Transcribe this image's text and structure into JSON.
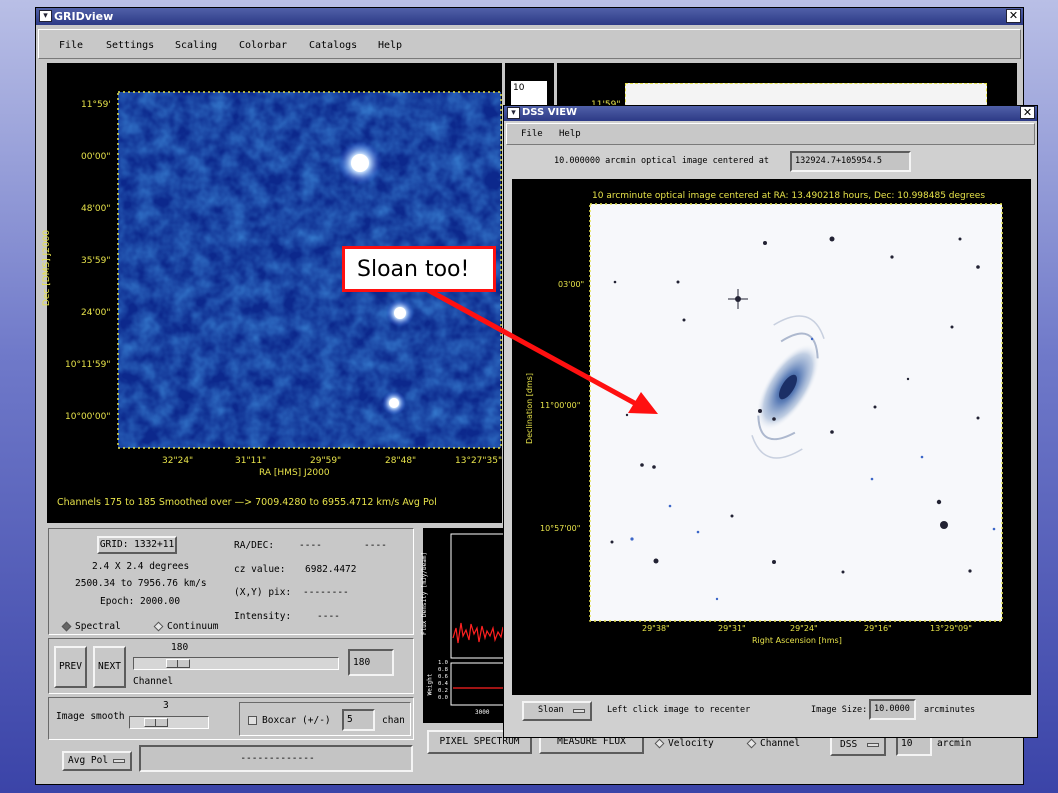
{
  "grid_window": {
    "title": "GRIDview",
    "menu": [
      "File",
      "Settings",
      "Scaling",
      "Colorbar",
      "Catalogs",
      "Help"
    ],
    "map": {
      "dec_axis_label": "Dec [DMS] J2000",
      "ra_axis_label": "RA [HMS] J2000",
      "dec_ticks": [
        "11°59'",
        "00'00\"",
        "48'00\"",
        "35'59\"",
        "24'00\"",
        "10°11'59\"",
        "10°00'00\""
      ],
      "ra_ticks": [
        "32\"24\"",
        "31\"11\"",
        "29\"59\"",
        "28\"48\"",
        "13°27\"35\""
      ],
      "caption": "Channels 175 to 185  Smoothed over —> 7009.4280 to 6955.4712 km/s   Avg Pol"
    },
    "info": {
      "grid_label": "GRID: 1332+11",
      "size": "2.4 X  2.4 degrees",
      "velocity_range": "2500.34 to 7956.76 km/s",
      "epoch": "Epoch: 2000.00",
      "radec_label": "RA/DEC:",
      "radec_value1": "----",
      "radec_value2": "----",
      "cz_label": "cz value:",
      "cz_value": "6982.4472",
      "xy_label": "(X,Y) pix:",
      "xy_value": "--------",
      "intensity_label": "Intensity:",
      "intensity_value": "----",
      "spectral_label": "Spectral",
      "continuum_label": "Continuum"
    },
    "channel": {
      "prev_label": "PREV",
      "next_label": "NEXT",
      "slider_value": "180",
      "slider_title": "Channel",
      "field_value": "180",
      "slider_fraction": 0.18
    },
    "smooth": {
      "label": "Image smooth",
      "slider_value": "3",
      "boxcar_label": "Boxcar (+/-)",
      "boxcar_value": "5",
      "chan_label": "chan",
      "slider_fraction": 0.25
    },
    "bottom": {
      "avg_pol": "Avg Pol",
      "status": "-------------",
      "pixel_spectrum": "PIXEL SPECTRUM",
      "measure_flux": "MEASURE FLUX",
      "velocity": "Velocity",
      "channel": "Channel",
      "dss": "DSS",
      "arcmin_value": "10",
      "arcmin_label": "arcmin"
    },
    "spectrum": {
      "ylabel_top": "Flux Density [mJy/beam]",
      "ylabel_bottom": "Weight",
      "weight_ticks": [
        "1.0",
        "0.8",
        "0.6",
        "0.4",
        "0.2",
        "0.0"
      ],
      "x_tick": "3000"
    },
    "second_map": {
      "count_label": "10",
      "dec_tick": "11'59\""
    }
  },
  "dss_window": {
    "title": "DSS VIEW",
    "menu": [
      "File",
      "Help"
    ],
    "header_text": "10.000000 arcmin optical image centered at",
    "coord_value": "132924.7+105954.5",
    "image_title": "10 arcminute optical image centered at RA: 13.490218 hours, Dec: 10.998485 degrees",
    "dec_axis_label": "Declination [dms]",
    "ra_axis_label": "Right Ascension [hms]",
    "dec_ticks": [
      "03'00\"",
      "11°00'00\"",
      "10°57'00\""
    ],
    "ra_ticks": [
      "29\"38\"",
      "29\"31\"",
      "29\"24\"",
      "29\"16\"",
      "13°29\"09\""
    ],
    "survey_button": "Sloan",
    "help_text": "Left click image to recenter",
    "size_label": "Image Size:",
    "size_value": "10.0000",
    "size_unit": "arcminutes"
  },
  "annotation": {
    "text": "Sloan too!",
    "color": "#ff0000"
  }
}
